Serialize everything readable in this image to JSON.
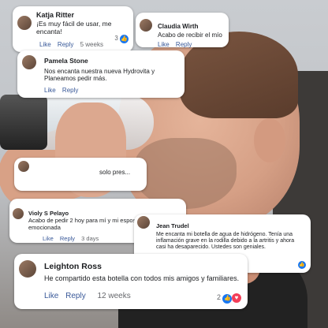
{
  "comments": [
    {
      "name": "Katja Ritter",
      "text": "¡Es muy fácil de usar, me encanta!",
      "like": "Like",
      "reply": "Reply",
      "time": "5 weeks",
      "reactions": "3"
    },
    {
      "name": "Claudia Wirth",
      "text": "Acabo de recibir el mío",
      "like": "Like",
      "reply": "Reply",
      "time": ""
    },
    {
      "name": "Pamela Stone",
      "text": "Nos encanta nuestra nueva Hydrovita y Planeamos pedir más.",
      "like": "Like",
      "reply": "Reply",
      "time": ""
    },
    {
      "name": "",
      "text": "solo pres...",
      "like": "",
      "reply": "",
      "time": ""
    },
    {
      "name": "Violy S Pelayo",
      "text": "Acabo de pedir 2 hoy para mí y mi esposo. Estoy emocionada",
      "like": "Like",
      "reply": "Reply",
      "time": "3 days"
    },
    {
      "name": "Jean Trudel",
      "text": "Me encanta mi botella de agua de hidrógeno. Tenía una inflamación grave en la rodilla debido a la artritis y ahora casi ha desaparecido. Ustedes son geniales.",
      "like": "",
      "reply": "",
      "time": ""
    },
    {
      "name": "Leighton Ross",
      "text": "He compartido esta botella con todos mis amigos y familiares.",
      "like": "Like",
      "reply": "Reply",
      "time": "12 weeks",
      "reactions": "2"
    }
  ],
  "icons": {
    "like": "like-icon",
    "love": "love-icon",
    "thumb_glyph": "👍",
    "heart_glyph": "♥"
  },
  "colors": {
    "link": "#385898",
    "like": "#1877f2",
    "love": "#f33e58"
  }
}
